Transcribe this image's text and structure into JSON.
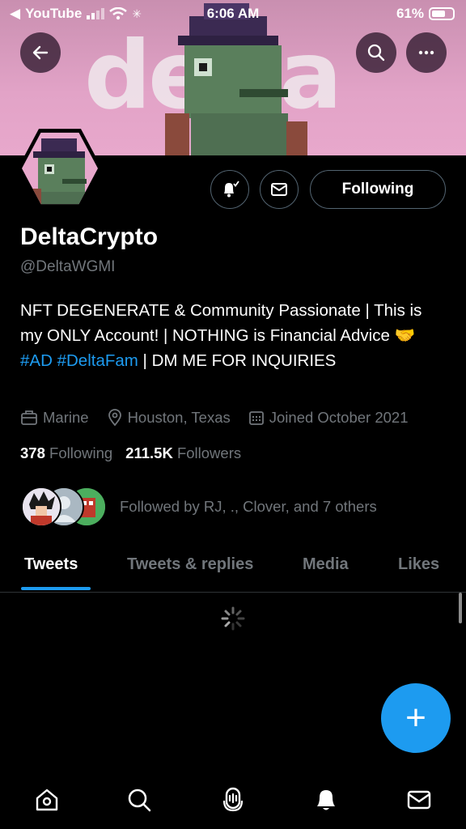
{
  "status_bar": {
    "back_app": "YouTube",
    "time": "6:06 AM",
    "battery": "61%"
  },
  "banner": {
    "word": "delta"
  },
  "profile": {
    "display_name": "DeltaCrypto",
    "handle": "@DeltaWGMI",
    "bio_text_1": "NFT DEGENERATE & Community Passionate | This is my ONLY Account! | NOTHING is Financial Advice ",
    "bio_emoji": "🤝",
    "bio_tag_1": "#AD",
    "bio_tag_2": "#DeltaFam",
    "bio_text_2": " | DM ME FOR INQUIRIES",
    "work": "Marine",
    "location": "Houston, Texas",
    "joined": "Joined October 2021",
    "following_count": "378",
    "following_label": "Following",
    "followers_count": "211.5K",
    "followers_label": "Followers",
    "followed_by": "Followed by RJ, ., Clover, and 7 others"
  },
  "actions": {
    "following_button": "Following"
  },
  "tabs": [
    {
      "label": "Tweets"
    },
    {
      "label": "Tweets & replies"
    },
    {
      "label": "Media"
    },
    {
      "label": "Likes"
    }
  ],
  "fab": {
    "label": "+"
  },
  "colors": {
    "accent": "#1d9bf0",
    "banner": "#e2a3c7",
    "background": "#000000"
  }
}
